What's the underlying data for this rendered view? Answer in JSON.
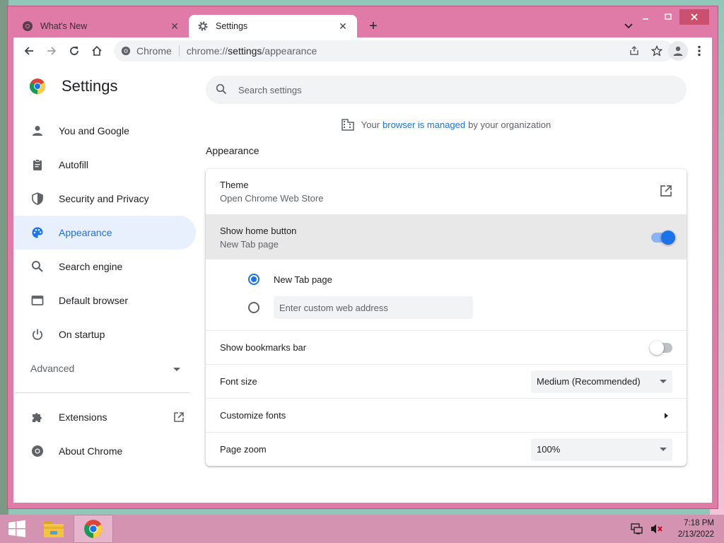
{
  "browser": {
    "tabs": [
      {
        "title": "What's New",
        "close": "✕"
      },
      {
        "title": "Settings",
        "close": "✕"
      }
    ],
    "new_tab": "+",
    "omnibox": {
      "site": "Chrome",
      "url_prefix": "chrome://",
      "url_host": "settings",
      "url_path": "/appearance"
    }
  },
  "header": {
    "title": "Settings"
  },
  "sidebar": {
    "items": [
      {
        "label": "You and Google",
        "icon": "person-icon"
      },
      {
        "label": "Autofill",
        "icon": "clipboard-icon"
      },
      {
        "label": "Security and Privacy",
        "icon": "shield-icon"
      },
      {
        "label": "Appearance",
        "icon": "palette-icon"
      },
      {
        "label": "Search engine",
        "icon": "search-icon"
      },
      {
        "label": "Default browser",
        "icon": "browser-window-icon"
      },
      {
        "label": "On startup",
        "icon": "power-icon"
      }
    ],
    "advanced": "Advanced",
    "extensions": "Extensions",
    "about": "About Chrome"
  },
  "search": {
    "placeholder": "Search settings"
  },
  "managed": {
    "before": "Your",
    "link": "browser is managed",
    "after": "by your organization"
  },
  "section": {
    "title": "Appearance"
  },
  "appearance": {
    "theme": {
      "label": "Theme",
      "sub": "Open Chrome Web Store"
    },
    "home_button": {
      "label": "Show home button",
      "sub": "New Tab page",
      "enabled": true
    },
    "home_options": {
      "new_tab": "New Tab page",
      "custom_placeholder": "Enter custom web address"
    },
    "bookmarks_bar": {
      "label": "Show bookmarks bar",
      "enabled": false
    },
    "font_size": {
      "label": "Font size",
      "value": "Medium (Recommended)"
    },
    "customize_fonts": {
      "label": "Customize fonts"
    },
    "page_zoom": {
      "label": "Page zoom",
      "value": "100%"
    }
  },
  "taskbar": {
    "time": "7:18 PM",
    "date": "2/13/2022"
  },
  "colors": {
    "accent": "#1a73e8",
    "frame": "#e07aa6",
    "taskbar": "#d493b1"
  }
}
